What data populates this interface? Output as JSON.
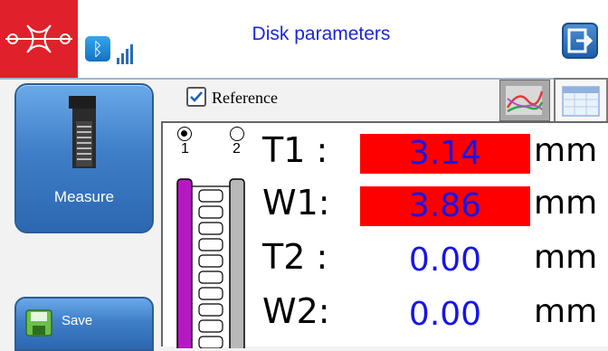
{
  "header": {
    "title": "Disk parameters",
    "logo_icon": "brand-logo",
    "bluetooth_icon": "bluetooth-icon",
    "signal_icon": "signal-strength-icon",
    "exit_icon": "exit-icon",
    "brand_color": "#e0212b"
  },
  "sidebar": {
    "measure_label": "Measure",
    "measure_icon": "caliper-device-icon",
    "save_label": "Save",
    "save_icon": "floppy-disk-icon"
  },
  "reference": {
    "label": "Reference",
    "checked": true
  },
  "view_tabs": [
    {
      "name": "chart",
      "icon": "line-chart-icon",
      "selected": false
    },
    {
      "name": "table",
      "icon": "table-icon",
      "selected": true
    }
  ],
  "disk_selector": {
    "options": [
      {
        "label": "1",
        "selected": true
      },
      {
        "label": "2",
        "selected": false
      }
    ]
  },
  "measurements": [
    {
      "label": "T1 :",
      "value": "3.14",
      "unit": "mm",
      "alarm": true
    },
    {
      "label": "W1:",
      "value": "3.86",
      "unit": "mm",
      "alarm": true
    },
    {
      "label": "T2 :",
      "value": "0.00",
      "unit": "mm",
      "alarm": false
    },
    {
      "label": "W2:",
      "value": "0.00",
      "unit": "mm",
      "alarm": false
    }
  ],
  "colors": {
    "alarm": "#ff0000",
    "value_text": "#1515e8",
    "button_blue": "#3f7fc8",
    "disk_1": "#b519c2",
    "disk_2": "#b8b8b8"
  }
}
